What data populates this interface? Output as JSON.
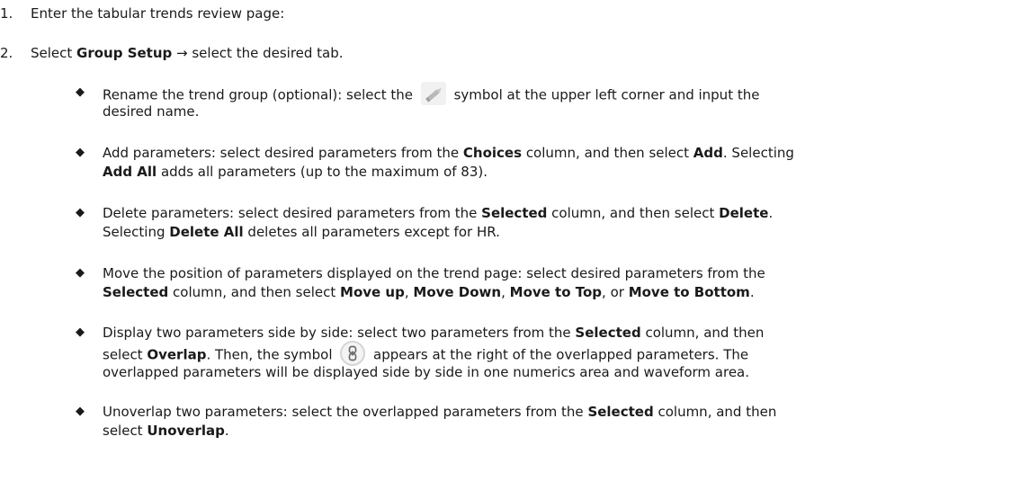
{
  "steps": [
    {
      "num": "1.",
      "text": "Enter the tabular trends review page:"
    },
    {
      "num": "2.",
      "pre": "Select ",
      "bold": "Group Setup",
      "post": " → select the desired tab."
    }
  ],
  "bullets": [
    {
      "lines": [
        [
          {
            "t": "Rename the trend group (optional): select the "
          },
          {
            "icon": "pencil-icon"
          },
          {
            "t": " symbol at the upper left corner and input the"
          }
        ],
        [
          {
            "t": "desired name."
          }
        ]
      ]
    },
    {
      "lines": [
        [
          {
            "t": "Add parameters: select desired parameters from the "
          },
          {
            "b": "Choices"
          },
          {
            "t": " column, and then select "
          },
          {
            "b": "Add"
          },
          {
            "t": ". Selecting"
          }
        ],
        [
          {
            "b": "Add All"
          },
          {
            "t": " adds all parameters (up to the maximum of 83)."
          }
        ]
      ]
    },
    {
      "lines": [
        [
          {
            "t": "Delete parameters: select desired parameters from the "
          },
          {
            "b": "Selected"
          },
          {
            "t": " column, and then select "
          },
          {
            "b": "Delete"
          },
          {
            "t": "."
          }
        ],
        [
          {
            "t": "Selecting "
          },
          {
            "b": "Delete All"
          },
          {
            "t": " deletes all parameters except for HR."
          }
        ]
      ]
    },
    {
      "lines": [
        [
          {
            "t": "Move the position of parameters displayed on the trend page: select desired parameters from the"
          }
        ],
        [
          {
            "b": "Selected"
          },
          {
            "t": " column, and then select "
          },
          {
            "b": "Move up"
          },
          {
            "t": ", "
          },
          {
            "b": "Move Down"
          },
          {
            "t": ", "
          },
          {
            "b": "Move to Top"
          },
          {
            "t": ", or "
          },
          {
            "b": "Move to Bottom"
          },
          {
            "t": "."
          }
        ]
      ]
    },
    {
      "lines": [
        [
          {
            "t": "Display two parameters side by side: select two parameters from the "
          },
          {
            "b": "Selected"
          },
          {
            "t": " column, and then"
          }
        ],
        [
          {
            "t": "select "
          },
          {
            "b": "Overlap"
          },
          {
            "t": ". Then, the symbol "
          },
          {
            "icon": "link-icon"
          },
          {
            "t": " appears at the right of the overlapped parameters. The"
          }
        ],
        [
          {
            "t": "overlapped parameters will be displayed side by side in one numerics area and waveform area."
          }
        ]
      ]
    },
    {
      "lines": [
        [
          {
            "t": "Unoverlap two parameters: select the overlapped parameters from the "
          },
          {
            "b": "Selected"
          },
          {
            "t": " column, and then"
          }
        ],
        [
          {
            "t": "select "
          },
          {
            "b": "Unoverlap"
          },
          {
            "t": "."
          }
        ]
      ]
    }
  ],
  "bullet_symbol": "◆"
}
